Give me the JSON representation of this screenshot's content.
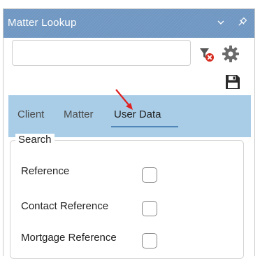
{
  "panel": {
    "title": "Matter Lookup",
    "collapse_icon": "chevron-down-icon",
    "pin_icon": "pin-icon",
    "accent_color": "#6f97c2"
  },
  "search": {
    "value": "",
    "placeholder": ""
  },
  "toolbar": {
    "filter_icon": "filter-clear-icon",
    "settings_icon": "gear-icon",
    "save_icon": "save-icon"
  },
  "tabs": {
    "items": [
      {
        "label": "Client"
      },
      {
        "label": "Matter"
      },
      {
        "label": "User Data"
      }
    ],
    "active": "User Data",
    "strip_color": "#a9cde7"
  },
  "search_group": {
    "legend": "Search",
    "fields": [
      {
        "label": "Reference",
        "checked": false
      },
      {
        "label": "Contact Reference",
        "checked": false
      },
      {
        "label": "Mortgage Reference",
        "checked": false
      }
    ]
  }
}
